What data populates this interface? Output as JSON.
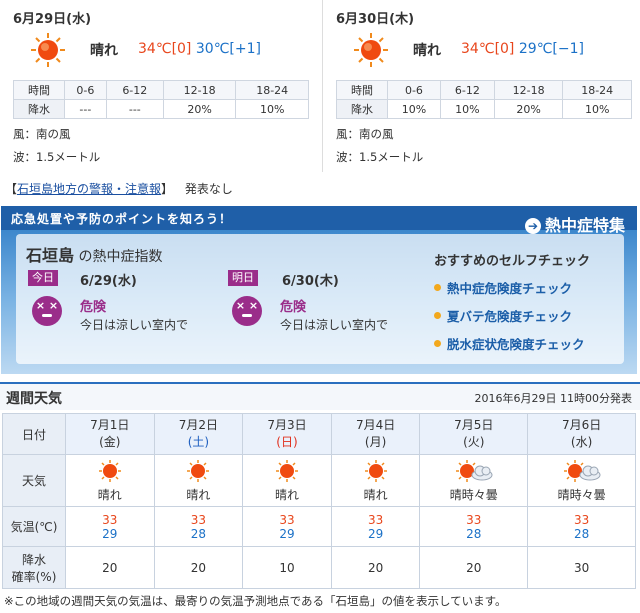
{
  "days": [
    {
      "date": "6月29日(水)",
      "weather": "晴れ",
      "high": "34",
      "high_unit": "℃",
      "high_diff": "[0]",
      "low": "30",
      "low_unit": "℃",
      "low_diff": "[+1]",
      "precip_headers": [
        "時間",
        "0-6",
        "6-12",
        "12-18",
        "18-24"
      ],
      "precip_values": [
        "降水",
        "---",
        "---",
        "20%",
        "10%"
      ],
      "wind": "風：南の風",
      "wave": "波：1.5メートル"
    },
    {
      "date": "6月30日(木)",
      "weather": "晴れ",
      "high": "34",
      "high_unit": "℃",
      "high_diff": "[0]",
      "low": "29",
      "low_unit": "℃",
      "low_diff": "[−1]",
      "precip_headers": [
        "時間",
        "0-6",
        "6-12",
        "12-18",
        "18-24"
      ],
      "precip_values": [
        "降水",
        "10%",
        "10%",
        "20%",
        "10%"
      ],
      "wind": "風：南の風",
      "wave": "波：1.5メートル"
    }
  ],
  "warning": {
    "open": "【",
    "link": "石垣島地方の警報・注意報",
    "close": "】",
    "status": "発表なし"
  },
  "heat": {
    "banner_title": "応急処置や予防のポイントを知ろう！",
    "feature_link": "熱中症特集",
    "place": "石垣島",
    "place_suffix": "の熱中症指数",
    "today_tag": "今日",
    "today_date": "6/29(水)",
    "today_level": "危険",
    "today_advice": "今日は涼しい室内で",
    "tomorrow_tag": "明日",
    "tomorrow_date": "6/30(木)",
    "tomorrow_level": "危険",
    "tomorrow_advice": "今日は涼しい室内で",
    "selfcheck_title": "おすすめのセルフチェック",
    "checks": [
      "熱中症危険度チェック",
      "夏バテ危険度チェック",
      "脱水症状危険度チェック"
    ]
  },
  "weekly": {
    "title": "週間天気",
    "issued": "2016年6月29日 11時00分発表",
    "row_labels": {
      "date": "日付",
      "weather": "天気",
      "temp": "気温(℃)",
      "precip_line1": "降水",
      "precip_line2": "確率(%)"
    },
    "days": [
      {
        "date": "7月1日",
        "dow": "(金)",
        "weather": "晴れ",
        "icon": "sun-icon",
        "high": "33",
        "low": "29",
        "precip": "20"
      },
      {
        "date": "7月2日",
        "dow": "(土)",
        "weather": "晴れ",
        "icon": "sun-icon",
        "high": "33",
        "low": "28",
        "precip": "20"
      },
      {
        "date": "7月3日",
        "dow": "(日)",
        "weather": "晴れ",
        "icon": "sun-icon",
        "high": "33",
        "low": "29",
        "precip": "10"
      },
      {
        "date": "7月4日",
        "dow": "(月)",
        "weather": "晴れ",
        "icon": "sun-icon",
        "high": "33",
        "low": "29",
        "precip": "20"
      },
      {
        "date": "7月5日",
        "dow": "(火)",
        "weather": "晴時々曇",
        "icon": "sun-cloud-icon",
        "high": "33",
        "low": "28",
        "precip": "20"
      },
      {
        "date": "7月6日",
        "dow": "(水)",
        "weather": "晴時々曇",
        "icon": "sun-cloud-icon",
        "high": "33",
        "low": "28",
        "precip": "30"
      }
    ]
  },
  "footnote": "※この地域の週間天気の気温は、最寄りの気温予測地点である「石垣島」の値を表示しています。"
}
